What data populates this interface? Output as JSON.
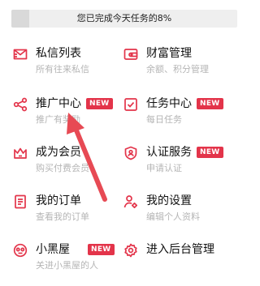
{
  "progress": {
    "text": "您已完成今天任务的8%",
    "percent": 8
  },
  "menu": {
    "messages": {
      "title": "私信列表",
      "sub": "所有往来私信"
    },
    "wealth": {
      "title": "财富管理",
      "sub": "余额、积分管理"
    },
    "promotion": {
      "title": "推广中心",
      "sub": "推广有奖励",
      "badge": "NEW"
    },
    "tasks": {
      "title": "任务中心",
      "sub": "每日任务",
      "badge": "NEW"
    },
    "membership": {
      "title": "成为会员",
      "sub": "购买付费会员"
    },
    "verify": {
      "title": "认证服务",
      "sub": "申请认证",
      "badge": "NEW"
    },
    "orders": {
      "title": "我的订单",
      "sub": "查看我的订单"
    },
    "settings": {
      "title": "我的设置",
      "sub": "编辑个人资料"
    },
    "blackroom": {
      "title": "小黑屋",
      "sub": "关进小黑屋的人",
      "badge": "NEW"
    },
    "admin": {
      "title": "进入后台管理",
      "sub": ""
    }
  },
  "colors": {
    "accent": "#e3344a",
    "sub_text": "#b5b5b5",
    "progress_bg": "#efefef"
  }
}
